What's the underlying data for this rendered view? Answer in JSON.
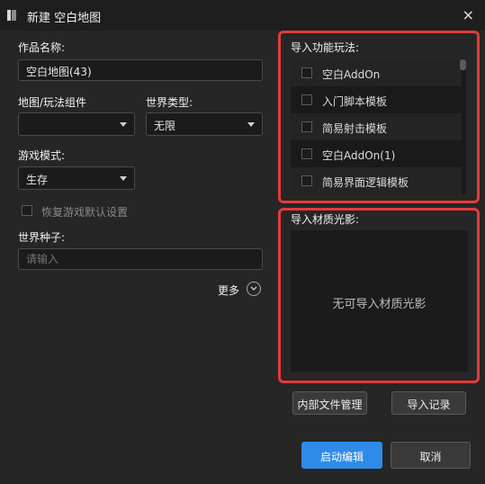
{
  "window": {
    "title": "新建 空白地图",
    "close_glyph": "×"
  },
  "form": {
    "work_name_label": "作品名称:",
    "work_name_value": "空白地图(43)",
    "map_component_label": "地图/玩法组件",
    "map_component_value": "",
    "world_type_label": "世界类型:",
    "world_type_value": "无限",
    "game_mode_label": "游戏模式:",
    "game_mode_value": "生存",
    "restore_default_label": "恢复游戏默认设置",
    "seed_label": "世界种子:",
    "seed_placeholder": "请输入",
    "more_label": "更多"
  },
  "import_features": {
    "label": "导入功能玩法:",
    "items": [
      {
        "label": "空白AddOn"
      },
      {
        "label": "入门脚本模板"
      },
      {
        "label": "简易射击模板"
      },
      {
        "label": "空白AddOn(1)"
      },
      {
        "label": "简易界面逻辑模板"
      }
    ]
  },
  "import_materials": {
    "label": "导入材质光影:",
    "empty_text": "无可导入材质光影"
  },
  "buttons": {
    "internal_files": "内部文件管理",
    "import_log": "导入记录",
    "start_edit": "启动编辑",
    "cancel": "取消"
  },
  "colors": {
    "accent": "#2f8be8",
    "highlight": "#e23b3b"
  }
}
